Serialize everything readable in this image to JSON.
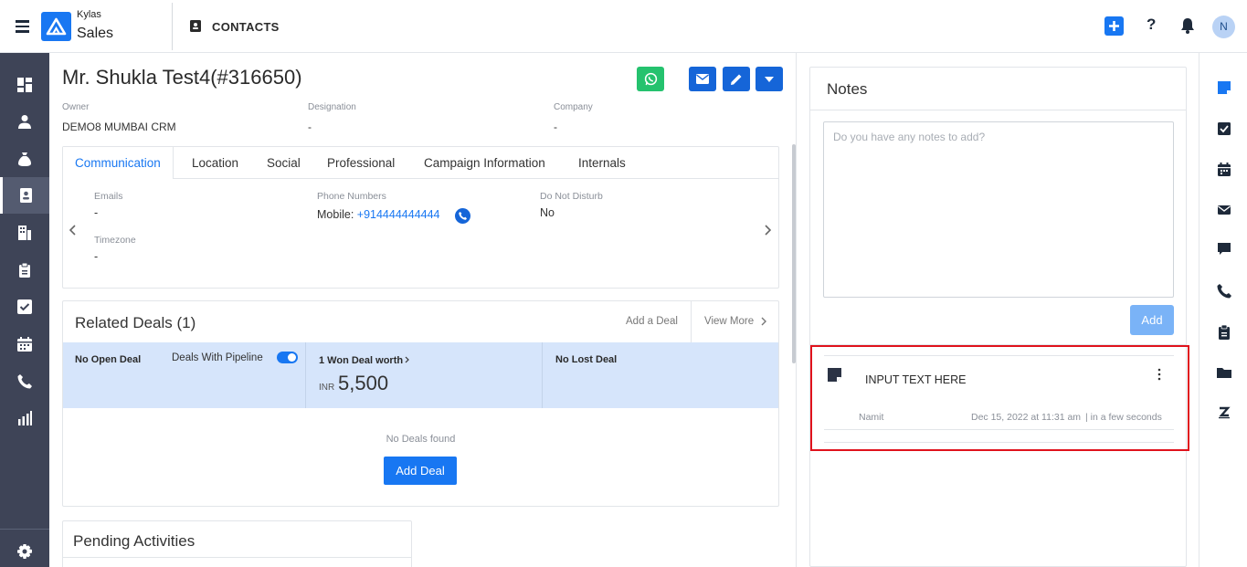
{
  "app": {
    "brand_name": "Kylas",
    "brand_sub": "Sales",
    "module_title": "CONTACTS",
    "help_label": "?",
    "avatar_initial": "N",
    "accent_color": "#1877f2",
    "sidebar_color": "#3e4457"
  },
  "contact": {
    "name": "Mr. Shukla Test4(#316650)",
    "owner_label": "Owner",
    "owner_value": "DEMO8 MUMBAI CRM",
    "designation_label": "Designation",
    "designation_value": "-",
    "company_label": "Company",
    "company_value": "-"
  },
  "tabs": [
    "Communication",
    "Location",
    "Social",
    "Professional",
    "Campaign Information",
    "Internals"
  ],
  "communication": {
    "emails_label": "Emails",
    "emails_value": "-",
    "phone_label": "Phone Numbers",
    "phone_prefix": "Mobile: ",
    "phone_value": "+914444444444",
    "dnd_label": "Do Not Disturb",
    "dnd_value": "No",
    "timezone_label": "Timezone",
    "timezone_value": "-"
  },
  "deals": {
    "title": "Related Deals (1)",
    "add_link": "Add a Deal",
    "view_more": "View More",
    "open_label": "No Open Deal",
    "pipeline_label": "Deals With Pipeline",
    "won_label": "1 Won Deal worth",
    "currency": "INR",
    "won_amount": "5,500",
    "lost_label": "No Lost Deal",
    "empty_text": "No Deals found",
    "add_button": "Add Deal"
  },
  "pending": {
    "title": "Pending Activities"
  },
  "notes": {
    "title": "Notes",
    "placeholder": "Do you have any notes to add?",
    "add_button": "Add",
    "items": [
      {
        "text": "INPUT TEXT HERE",
        "author": "Namit",
        "date": "Dec 15, 2022 at 11:31 am",
        "relative": "| in a few seconds"
      }
    ]
  },
  "sidebar_icons": [
    "dashboard-icon",
    "user-icon",
    "money-bag-icon",
    "contacts-icon",
    "building-icon",
    "clipboard-icon",
    "checkbox-icon",
    "calendar-icon",
    "phone-icon",
    "reports-icon",
    "settings-icon"
  ],
  "rail_icons": [
    "note-icon",
    "task-icon",
    "calendar-icon",
    "email-icon",
    "chat-icon",
    "phone-icon",
    "quote-icon",
    "folder-icon",
    "zoom-icon"
  ]
}
